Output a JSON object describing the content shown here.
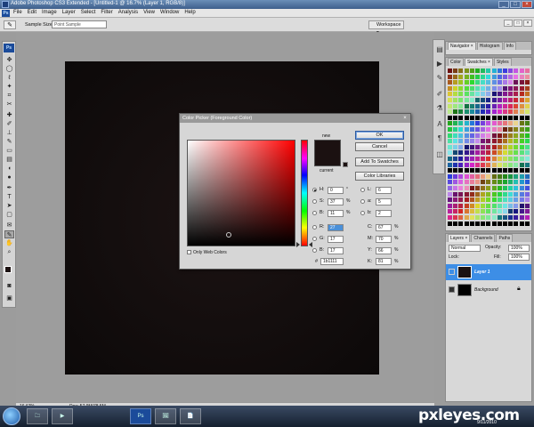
{
  "window": {
    "title": "Adobe Photoshop CS3 Extended - [Untitled-1 @ 16.7% (Layer 1, RGB/8)]",
    "controls": [
      "_",
      "□",
      "×"
    ]
  },
  "menubar": {
    "app_badge": "Ps",
    "items": [
      "File",
      "Edit",
      "Image",
      "Layer",
      "Select",
      "Filter",
      "Analysis",
      "View",
      "Window",
      "Help"
    ]
  },
  "options_bar": {
    "sample_size_label": "Sample Size:",
    "sample_size_value": "Point Sample",
    "workspace_label": "Workspace ▾",
    "doc_controls": [
      "_",
      "□",
      "×"
    ]
  },
  "toolbox": {
    "badge": "Ps"
  },
  "color_picker": {
    "title": "Color Picker (Foreground Color)",
    "close": "×",
    "new_label": "new",
    "current_label": "current",
    "buttons": {
      "ok": "OK",
      "cancel": "Cancel",
      "add_to_swatches": "Add To Swatches",
      "color_libraries": "Color Libraries"
    },
    "fields": {
      "H": "0",
      "S": "37",
      "B": "11",
      "R": "27",
      "G": "17",
      "Bl": "17",
      "L": "6",
      "a": "5",
      "b": "2",
      "C": "67",
      "M": "70",
      "Y": "66",
      "K": "81"
    },
    "field_labels": {
      "H": "H:",
      "S": "S:",
      "B": "B:",
      "R": "R:",
      "G": "G:",
      "Bl": "B:",
      "L": "L:",
      "a": "a:",
      "b": "b:",
      "C": "C:",
      "M": "M:",
      "Y": "Y:",
      "K": "K:"
    },
    "units": {
      "H": "°",
      "pct": "%"
    },
    "hex_label": "#",
    "hex": "1b1111",
    "only_web_colors": "Only Web Colors",
    "new_color": "#1b1111",
    "current_color": "#ffffff"
  },
  "panels": {
    "navigator_tabs": [
      "Navigator ×",
      "Histogram",
      "Info"
    ],
    "color_tabs": [
      "Color",
      "Swatches ×",
      "Styles"
    ],
    "layers_tabs": [
      "Layers ×",
      "Channels",
      "Paths"
    ],
    "layers_controls": {
      "blend": "Normal",
      "opacity_label": "Opacity:",
      "opacity": "100%",
      "lock_label": "Lock:",
      "fill_label": "Fill:",
      "fill": "100%"
    },
    "layers": [
      {
        "name": "Layer 1",
        "selected": true
      },
      {
        "name": "Background",
        "selected": false,
        "locked": true
      }
    ]
  },
  "status": {
    "zoom": "16.67%",
    "doc": "Doc: 57.9M/78.5M"
  },
  "taskbar": {
    "items": [
      "🗀",
      "▶",
      "Ps",
      "🖼",
      "📄"
    ]
  },
  "watermark": "pxleyes.com",
  "clock": "9/11/2010"
}
